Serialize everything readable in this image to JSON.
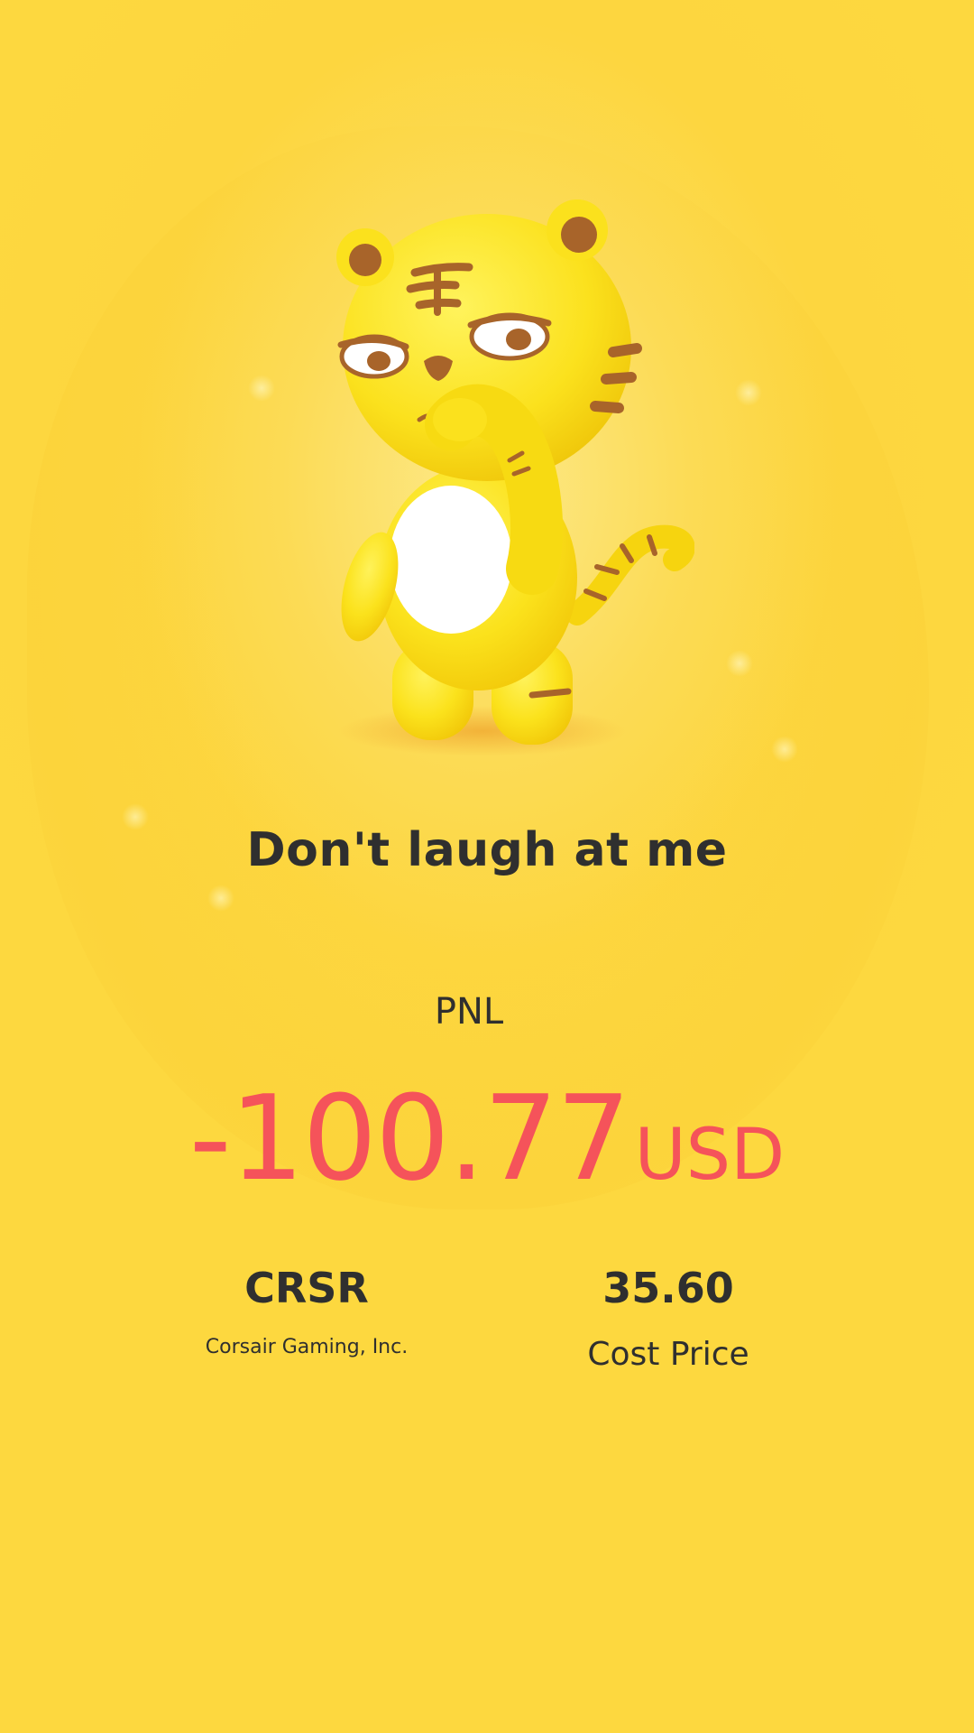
{
  "colors": {
    "background": "#fdd83f",
    "text": "#2f2f2f",
    "loss": "#f5535a"
  },
  "mascot": {
    "icon": "tiger-mascot-icon"
  },
  "headline": "Don't laugh at me",
  "pnl": {
    "label": "PNL",
    "value": "-100.77",
    "currency": "USD"
  },
  "stock": {
    "ticker": "CRSR",
    "company": "Corsair Gaming, Inc."
  },
  "cost": {
    "value": "35.60",
    "label": "Cost Price"
  }
}
